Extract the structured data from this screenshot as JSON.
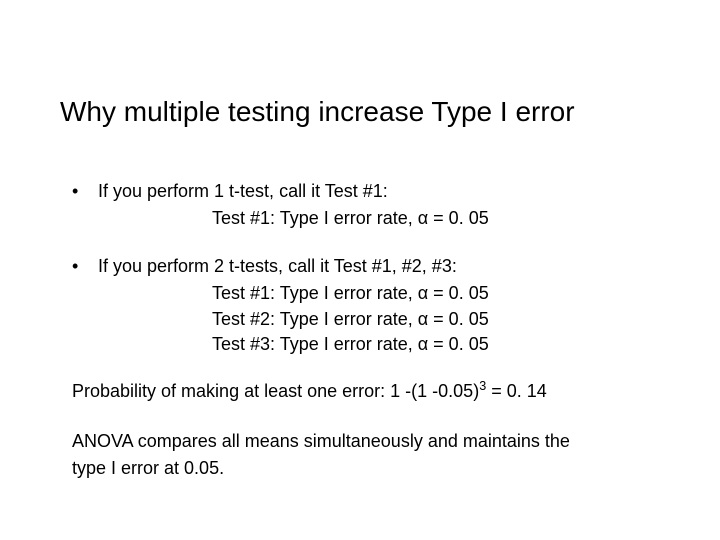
{
  "title": "Why multiple testing increase Type I error",
  "bullet1": {
    "lead": "If you perform 1 t-test, call it Test #1:",
    "lines": [
      "Test #1: Type I error rate, α = 0. 05"
    ]
  },
  "bullet2": {
    "lead": "If you perform 2 t-tests, call it Test #1, #2, #3:",
    "lines": [
      "Test #1: Type I error rate, α = 0. 05",
      "Test #2: Type I error rate, α = 0. 05",
      "Test #3: Type I error rate, α = 0. 05"
    ]
  },
  "prob_line_pre": "Probability of making at least one error: 1 -(1 -0.05)",
  "prob_exp": "3",
  "prob_line_post": " = 0. 14",
  "anova_line1": "ANOVA compares all means simultaneously and maintains the",
  "anova_line2": "type I error at 0.05."
}
